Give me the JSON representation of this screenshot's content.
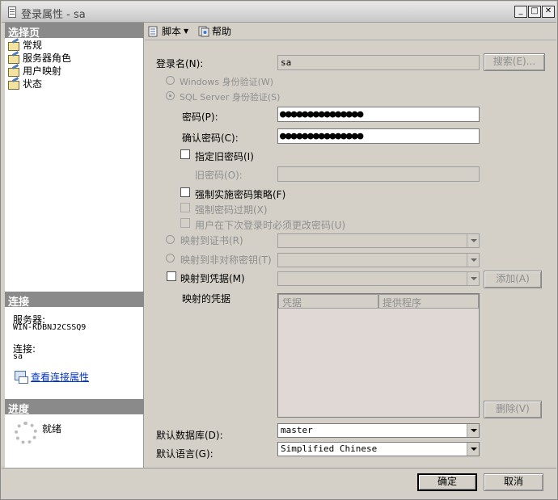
{
  "window": {
    "title": "登录属性 - sa"
  },
  "left": {
    "select_page_header": "选择页",
    "nav": [
      "常规",
      "服务器角色",
      "用户映射",
      "状态"
    ],
    "connection_header": "连接",
    "server_label": "服务器:",
    "server_value": "WIN-KDBNJ2CSSQ9",
    "conn_label": "连接:",
    "conn_value": "sa",
    "view_conn_link": "查看连接属性",
    "progress_header": "进度",
    "progress_status": "就绪"
  },
  "toolbar": {
    "script": "脚本",
    "help": "帮助"
  },
  "form": {
    "login_name_label": "登录名(N):",
    "login_name_value": "sa",
    "search_button": "搜索(E)...",
    "windows_auth": "Windows 身份验证(W)",
    "sql_auth": "SQL Server 身份验证(S)",
    "password_label": "密码(P):",
    "password_value": "●●●●●●●●●●●●●●●",
    "confirm_label": "确认密码(C):",
    "confirm_value": "●●●●●●●●●●●●●●●",
    "specify_old": "指定旧密码(I)",
    "old_password_label": "旧密码(O):",
    "enforce_policy": "强制实施密码策略(F)",
    "enforce_expiration": "强制密码过期(X)",
    "must_change": "用户在下次登录时必须更改密码(U)",
    "map_cert": "映射到证书(R)",
    "map_asym": "映射到非对称密钥(T)",
    "map_cred": "映射到凭据(M)",
    "add_button": "添加(A)",
    "mapped_creds_label": "映射的凭据",
    "col_cred": "凭据",
    "col_provider": "提供程序",
    "remove_button": "删除(V)",
    "default_db_label": "默认数据库(D):",
    "default_db_value": "master",
    "default_lang_label": "默认语言(G):",
    "default_lang_value": "Simplified Chinese"
  },
  "footer": {
    "ok": "确定",
    "cancel": "取消"
  }
}
